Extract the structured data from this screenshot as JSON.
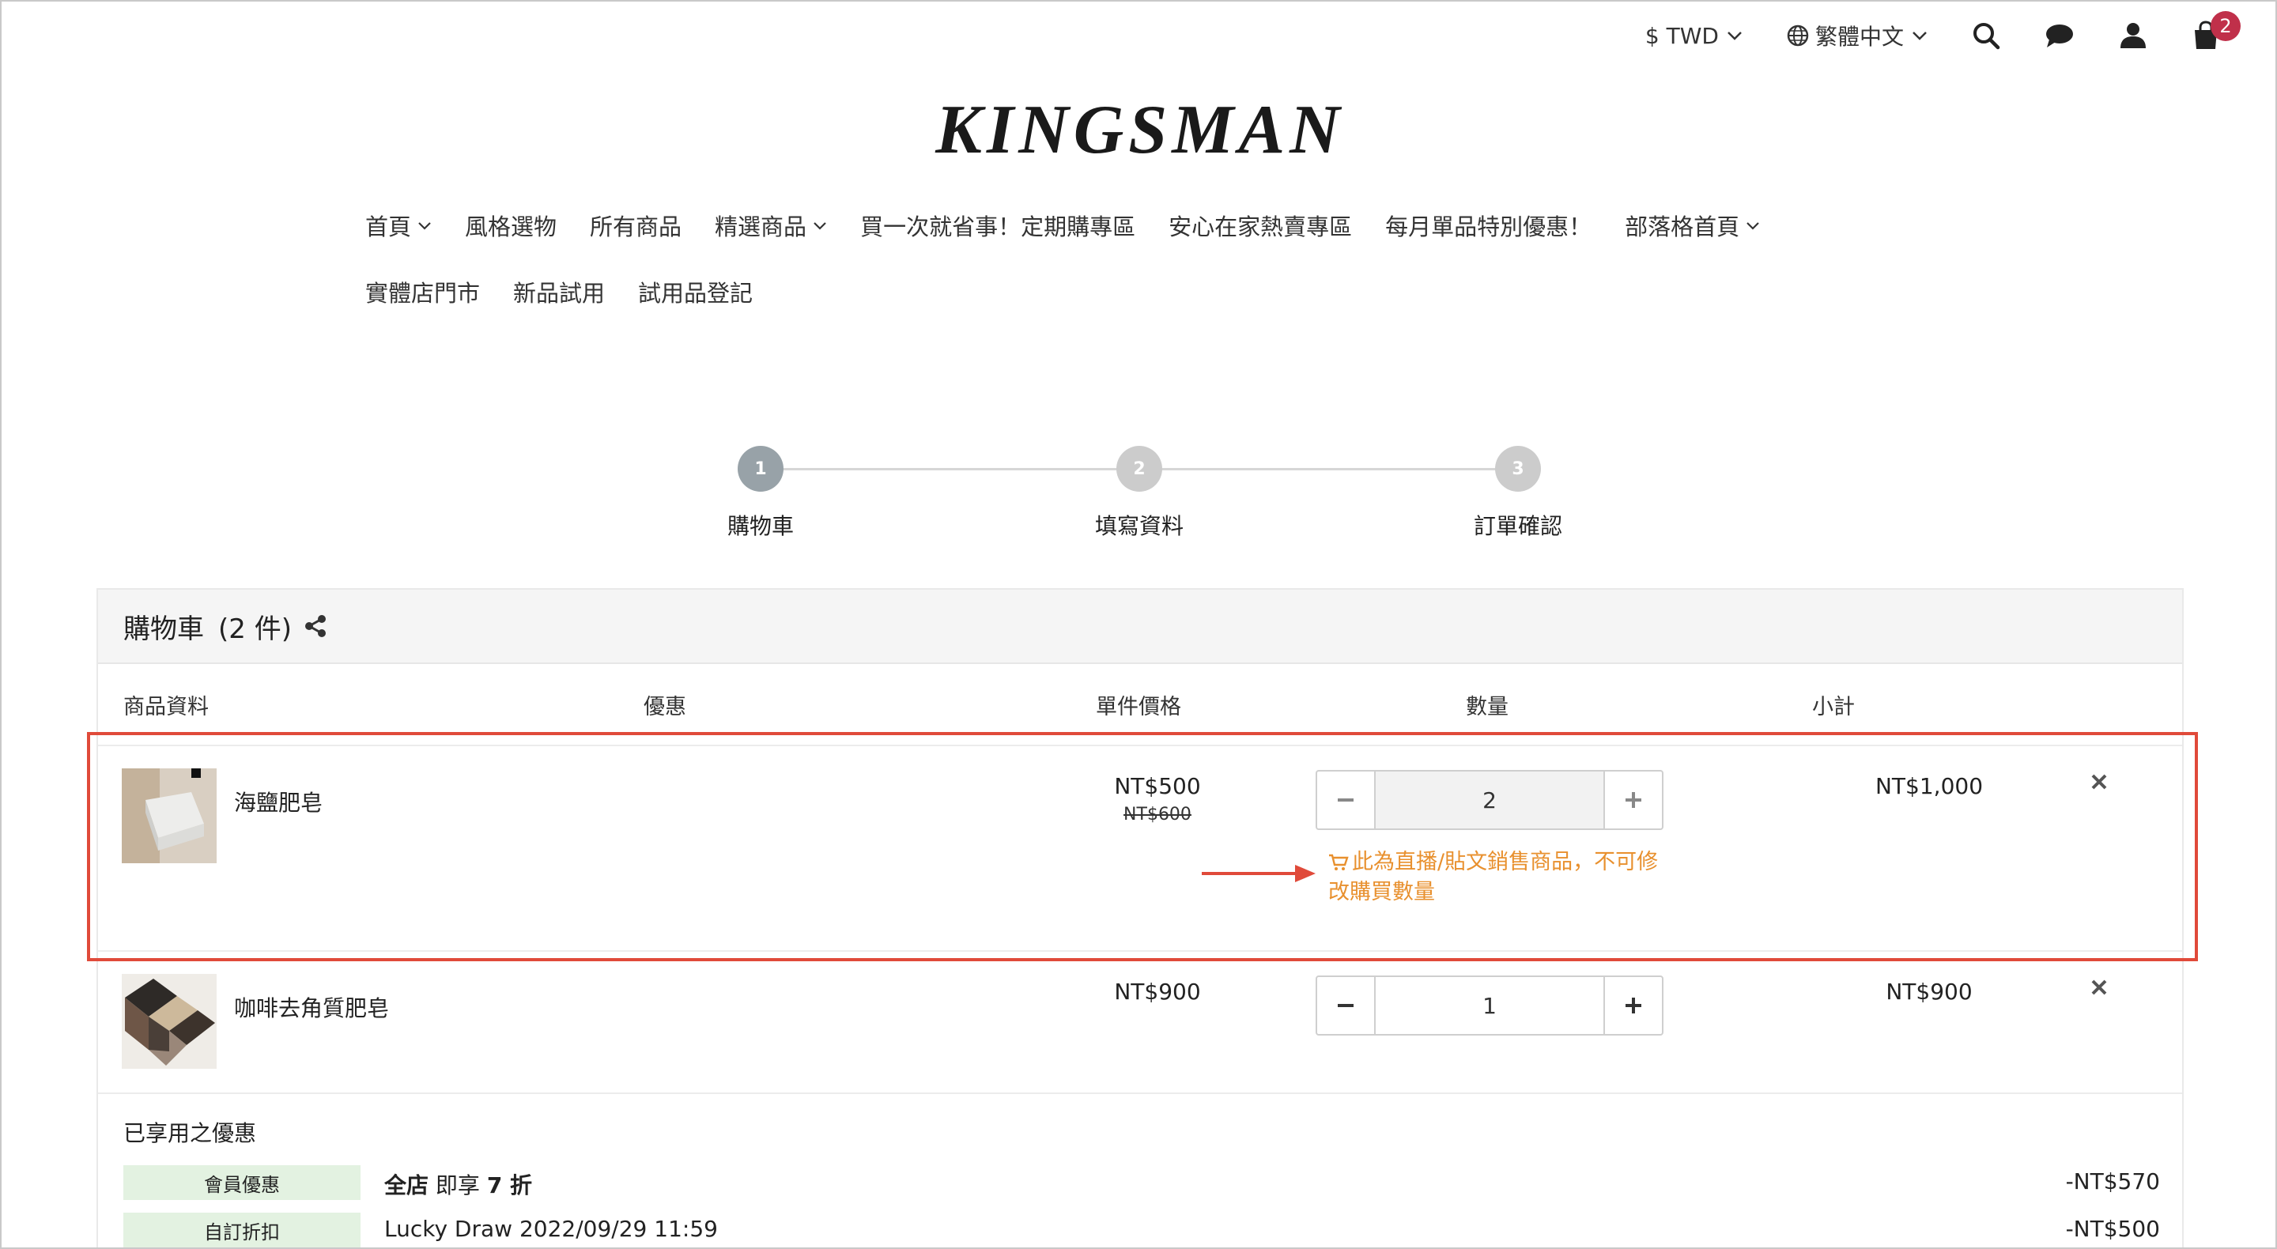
{
  "header": {
    "currency": "$ TWD",
    "language": "繁體中文",
    "cart_count": "2",
    "logo": "KINGSMAN"
  },
  "nav": {
    "row1": [
      "首頁",
      "風格選物",
      "所有商品",
      "精選商品",
      "買一次就省事！定期購專區",
      "安心在家熱賣專區",
      "每月單品特別優惠！",
      "部落格首頁"
    ],
    "row2": [
      "實體店門市",
      "新品試用",
      "試用品登記"
    ]
  },
  "steps": [
    {
      "num": "1",
      "label": "購物車"
    },
    {
      "num": "2",
      "label": "填寫資料"
    },
    {
      "num": "3",
      "label": "訂單確認"
    }
  ],
  "cart": {
    "title": "購物車",
    "count": "(2 件)",
    "columns": {
      "info": "商品資料",
      "discount": "優惠",
      "unit_price": "單件價格",
      "qty": "數量",
      "subtotal": "小計"
    },
    "items": [
      {
        "name": "海鹽肥皂",
        "price": "NT$500",
        "original_price": "NT$600",
        "qty": "2",
        "subtotal": "NT$1,000",
        "notice": "此為直播/貼文銷售商品，不可修改購買數量"
      },
      {
        "name": "咖啡去角質肥皂",
        "price": "NT$900",
        "qty": "1",
        "subtotal": "NT$900"
      }
    ]
  },
  "discounts": {
    "title": "已享用之優惠",
    "rows": [
      {
        "tag": "會員優惠",
        "desc_bold": "全店",
        "desc_mid": " 即享 ",
        "desc_bold2": "7 折",
        "amount": "-NT$570"
      },
      {
        "tag": "自訂折扣",
        "desc": "Lucky Draw 2022/09/29 11:59",
        "amount": "-NT$500"
      }
    ]
  },
  "colors": {
    "accent_notice": "#e8902e",
    "highlight_border": "#e04a3a",
    "badge": "#c0304a",
    "step_active": "#98a2a8",
    "step_inactive": "#cccccc",
    "discount_tag_bg": "#e3f2e1"
  }
}
